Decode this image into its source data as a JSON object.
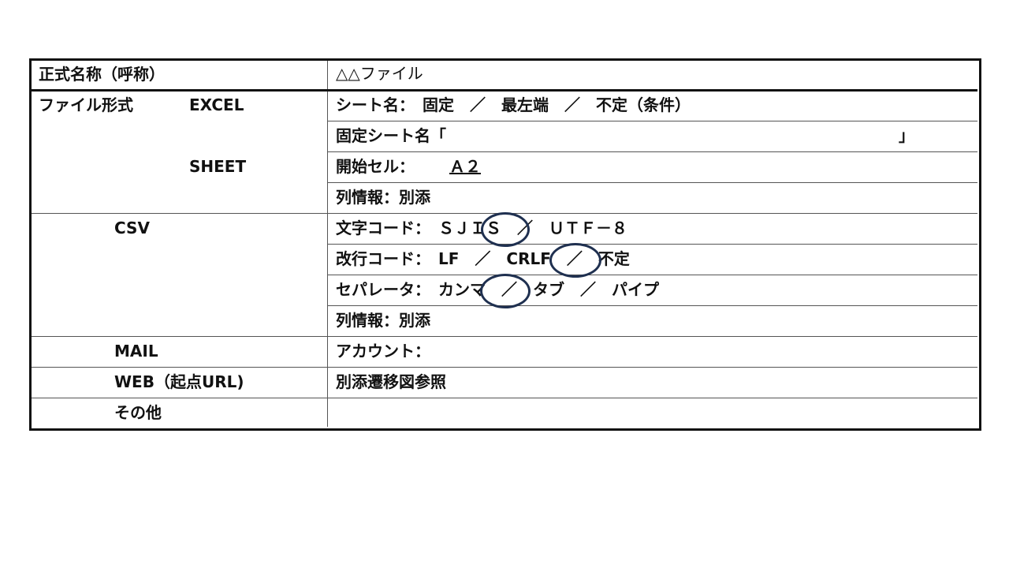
{
  "rows": {
    "official_name": {
      "label": "正式名称（呼称）",
      "value": "△△ファイル"
    },
    "file_format": {
      "label": "ファイル形式",
      "excel": "EXCEL",
      "sheet": "SHEET",
      "sheet_name": "シート名：　固定　／　最左端　／　不定（条件）",
      "fixed_sheet_name": "固定シート名「",
      "fixed_sheet_close": "」",
      "start_cell_label": "開始セル：",
      "start_cell_value": "Ａ２",
      "column_info": "列情報：別添"
    },
    "csv": {
      "label": "CSV",
      "char_code": "文字コード：　ＳＪＩＳ　／　ＵＴＦ－８",
      "newline": "改行コード：　LF　／　CRLF　／　不定",
      "separator": "セパレータ：　カンマ　／　タブ　／　パイプ",
      "column_info": "列情報：別添",
      "selected": [
        "ＳＪＩＳ",
        "CRLF",
        "カンマ"
      ]
    },
    "mail": {
      "label": "MAIL",
      "value": "アカウント："
    },
    "web": {
      "label": "WEB（起点URL)",
      "value": "別添遷移図参照"
    },
    "other": {
      "label": "その他",
      "value": ""
    }
  },
  "colors": {
    "circle": "#1f3050"
  }
}
